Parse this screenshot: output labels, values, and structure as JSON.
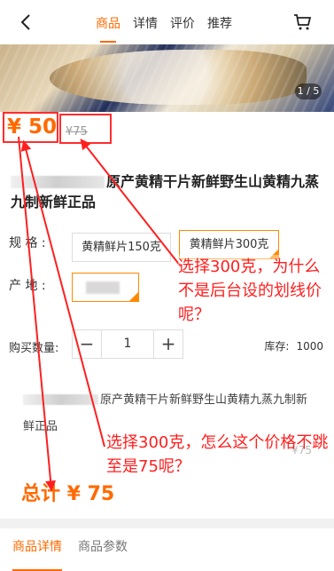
{
  "header": {
    "tabs": [
      "商品",
      "详情",
      "评价",
      "推荐"
    ],
    "active_tab": "商品"
  },
  "hero": {
    "pager": "1 / 5"
  },
  "product": {
    "price": "¥ 50",
    "original_price": "¥75",
    "title": "原产黄精干片新鲜野生山黄精九蒸九制新鲜正品",
    "spec_label": "规  格 :",
    "spec_options": [
      "黄精鲜片150克",
      "黄精鲜片300克"
    ],
    "origin_label": "产  地 :",
    "quantity_label": "购买数量:",
    "quantity_minus": "−",
    "quantity": "1",
    "quantity_plus": "+",
    "stock_label": "库存:",
    "stock_value": "1000"
  },
  "summary": {
    "title": "原产黄精干片新鲜野生山黄精九蒸九制新鲜正品",
    "line_price": "¥75",
    "total": "总计 ¥ 75"
  },
  "annotations": {
    "note1": "选择300克，为什么不是后台设的划线价呢？",
    "note2": "选择300克，怎么这个价格不跳至是75呢？"
  },
  "bottom_tabs": [
    "商品详情",
    "商品参数"
  ],
  "colors": {
    "accent": "#ff6a00",
    "annotation": "#ff1f1f",
    "selected_border": "#ff8a00"
  }
}
